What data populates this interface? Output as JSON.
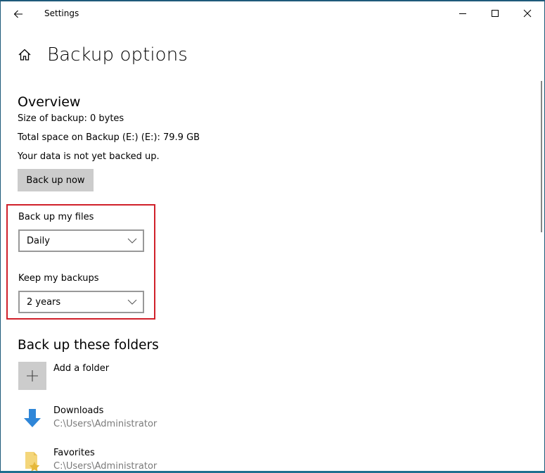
{
  "window": {
    "title": "Settings",
    "controls": {
      "minimize": "minimize",
      "maximize": "maximize",
      "close": "close"
    }
  },
  "header": {
    "icon": "home-icon",
    "title": "Backup options"
  },
  "overview": {
    "title": "Overview",
    "size": "Size of backup: 0 bytes",
    "total_space": "Total space on Backup (E:) (E:): 79.9 GB",
    "status": "Your data is not yet backed up.",
    "backup_now_label": "Back up now"
  },
  "settings": {
    "frequency": {
      "label": "Back up my files",
      "value": "Daily"
    },
    "retention": {
      "label": "Keep my backups",
      "value": "2 years"
    },
    "highlight_color": "#d0202a"
  },
  "folders": {
    "title": "Back up these folders",
    "add_label": "Add a folder",
    "items": [
      {
        "name": "Downloads",
        "path": "C:\\Users\\Administrator",
        "icon": "download-arrow-icon"
      },
      {
        "name": "Favorites",
        "path": "C:\\Users\\Administrator",
        "icon": "favorites-folder-icon"
      }
    ]
  }
}
